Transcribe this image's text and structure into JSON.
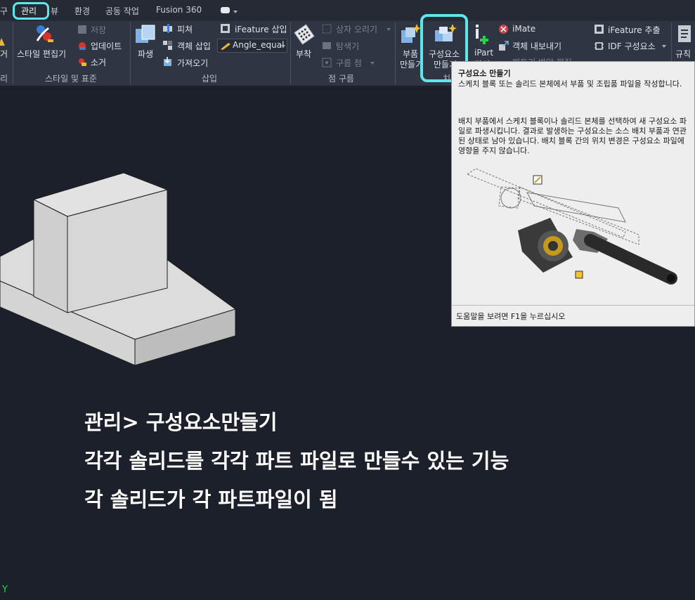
{
  "tabs": [
    "구",
    "관리",
    "뷰",
    "환경",
    "공동 작업",
    "Fusion 360"
  ],
  "ribbon": {
    "left_cut": {
      "big_label": "거",
      "group": "리"
    },
    "style": {
      "style_editor": "스타일 편집기",
      "save": "저장",
      "update": "업데이트",
      "purge": "소거",
      "group": "스타일 및 표준"
    },
    "insert": {
      "derive": "파생",
      "pitch": "피쳐",
      "insert_object": "객체 삽입",
      "import": "가져오기",
      "ifeature_insert": "iFeature 삽입",
      "angle_select": "Angle_equal",
      "group": "삽입"
    },
    "point_cloud": {
      "attach": "부착",
      "box_crop": "상자 오리기",
      "explore": "탐색기",
      "cloud_point": "구름 점",
      "group": "점 구름"
    },
    "layout": {
      "make_part_1": "부품",
      "make_part_2": "만들기",
      "make_comp_1": "구성요소",
      "make_comp_2": "만들기",
      "group": "치"
    },
    "author": {
      "ipart_1": "iPart",
      "ipart_2": "작성",
      "imate": "iMate",
      "export_object": "객체 내보내기",
      "param_table": "패트리 변압 편집",
      "ifeature_extract": "iFeature 추출",
      "idf_component": "IDF 구성요소"
    },
    "rules": {
      "label": "규칙"
    }
  },
  "tooltip": {
    "title": "구성요소 만들기",
    "p1": "스케치 블록 또는 솔리드 본체에서 부품 및 조립품 파일을 작성합니다.",
    "p2": "배치 부품에서 스케치 블록이나 솔리드 본체를 선택하여 새 구성요소 파일로 파생시킵니다. 결과로 발생하는 구성요소는 소스 배치 부품과 연관된 상태로 남아 있습니다. 배치 블록 간의 위치 변경은 구성요소 파일에 영향을 주지 않습니다.",
    "footer": "도움말을 보려면 F1을 누르십시오"
  },
  "overlay": {
    "line1": "관리> 구성요소만들기",
    "line2": "각각 솔리드를 각각 파트 파일로 만들수 있는 기능",
    "line3": "각 솔리드가 각 파트파일이 됨"
  },
  "axis": {
    "y": "Y"
  },
  "colors": {
    "highlight": "#5ee6ea",
    "background": "#1c202a",
    "ribbon": "#2f3542"
  }
}
